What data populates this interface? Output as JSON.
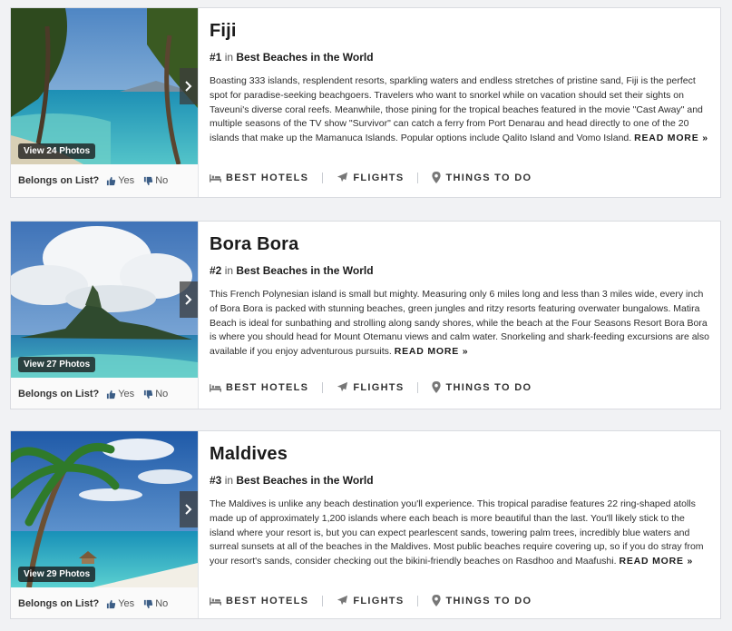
{
  "listing": [
    {
      "title": "Fiji",
      "rank": "#1",
      "rank_in": "in",
      "list_name": "Best Beaches in the World",
      "description": "Boasting 333 islands, resplendent resorts, sparkling waters and endless stretches of pristine sand, Fiji is the perfect spot for paradise-seeking beachgoers. Travelers who want to snorkel while on vacation should set their sights on Taveuni's diverse coral reefs. Meanwhile, those pining for the tropical beaches featured in the movie \"Cast Away\" and multiple seasons of the TV show \"Survivor\" can catch a ferry from Port Denarau and head directly to one of the 20 islands that make up the Mamanuca Islands. Popular options include Qalito Island and Vomo Island.",
      "read_more": "READ MORE »",
      "photos_label": "View 24 Photos",
      "vote_question": "Belongs on List?",
      "vote_yes": "Yes",
      "vote_no": "No"
    },
    {
      "title": "Bora Bora",
      "rank": "#2",
      "rank_in": "in",
      "list_name": "Best Beaches in the World",
      "description": "This French Polynesian island is small but mighty. Measuring only 6 miles long and less than 3 miles wide, every inch of Bora Bora is packed with stunning beaches, green jungles and ritzy resorts featuring overwater bungalows. Matira Beach is ideal for sunbathing and strolling along sandy shores, while the beach at the Four Seasons Resort Bora Bora is where you should head for Mount Otemanu views and calm water. Snorkeling and shark-feeding excursions are also available if you enjoy adventurous pursuits.",
      "read_more": "READ MORE »",
      "photos_label": "View 27 Photos",
      "vote_question": "Belongs on List?",
      "vote_yes": "Yes",
      "vote_no": "No"
    },
    {
      "title": "Maldives",
      "rank": "#3",
      "rank_in": "in",
      "list_name": "Best Beaches in the World",
      "description": "The Maldives is unlike any beach destination you'll experience. This tropical paradise features 22 ring-shaped atolls made up of approximately 1,200 islands where each beach is more beautiful than the last. You'll likely stick to the island where your resort is, but you can expect pearlescent sands, towering palm trees, incredibly blue waters and surreal sunsets at all of the beaches in the Maldives. Most public beaches require covering up, so if you do stray from your resort's sands, consider checking out the bikini-friendly beaches on Rasdhoo and Maafushi.",
      "read_more": "READ MORE »",
      "photos_label": "View 29 Photos",
      "vote_question": "Belongs on List?",
      "vote_yes": "Yes",
      "vote_no": "No"
    }
  ],
  "links": {
    "hotels": "BEST HOTELS",
    "flights": "FLIGHTS",
    "things": "THINGS TO DO"
  },
  "icons": {
    "arrow": "chevron-right-icon",
    "yes": "thumbs-up-icon",
    "no": "thumbs-down-icon",
    "hotels": "bed-icon",
    "flights": "airplane-icon",
    "things": "map-pin-icon"
  },
  "colors": {
    "vote_icon": "#3b5d86",
    "card_border": "#d9dbe0",
    "page_bg": "#f1f2f4"
  }
}
